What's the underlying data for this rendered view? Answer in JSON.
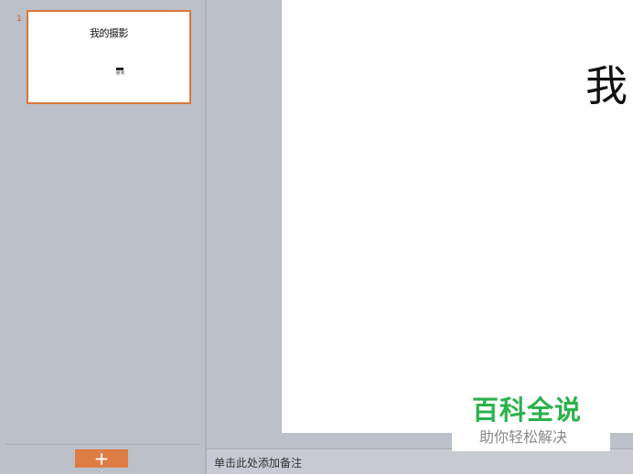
{
  "slide_panel": {
    "slides": [
      {
        "number": "1",
        "title": "我的摄影",
        "subtitle_line1": "",
        "subtitle_line2": "摄 影"
      }
    ],
    "add_slide_label": "+"
  },
  "canvas": {
    "slide_title": "我"
  },
  "notes": {
    "placeholder": "单击此处添加备注"
  },
  "watermark": {
    "main": "百科全说",
    "sub": "助你轻松解决"
  },
  "colors": {
    "accent": "#dd7d44",
    "background": "#bcc0c9",
    "watermark_green": "#2bb24c"
  }
}
